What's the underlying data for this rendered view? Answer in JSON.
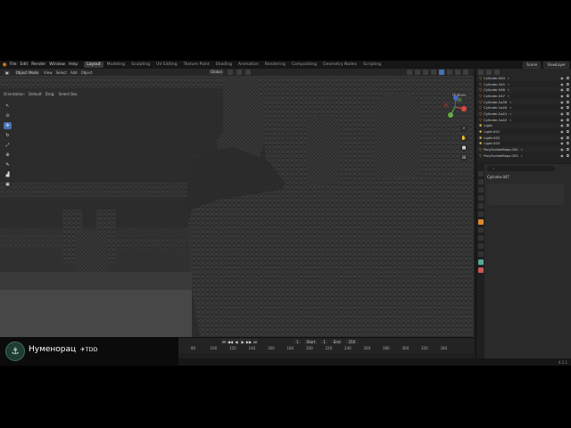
{
  "topbar": {
    "menu": [
      "File",
      "Edit",
      "Render",
      "Window",
      "Help"
    ],
    "workspaces": [
      "Layout",
      "Modeling",
      "Sculpting",
      "UV Editing",
      "Texture Paint",
      "Shading",
      "Animation",
      "Rendering",
      "Compositing",
      "Geometry Nodes",
      "Scripting"
    ],
    "active_workspace": "Layout",
    "scene": "Scene",
    "view_layer": "ViewLayer"
  },
  "viewport_header": {
    "mode": "Object Mode",
    "menus": [
      "View",
      "Select",
      "Add",
      "Object"
    ],
    "transform": "Global",
    "orientation_label": "Orientation:",
    "orientation_value": "Default",
    "drag_label": "Drag:",
    "drag_value": "Select Box",
    "options": "Options"
  },
  "outliner": {
    "items": [
      {
        "name": "Cylinder.044",
        "icon": "mesh-icon"
      },
      {
        "name": "Cylinder.045",
        "icon": "mesh-icon"
      },
      {
        "name": "Cylinder.046",
        "icon": "mesh-icon"
      },
      {
        "name": "Cylinder.047",
        "icon": "mesh-icon"
      },
      {
        "name": "Cylinder.1a39",
        "icon": "mesh-icon"
      },
      {
        "name": "Cylinder.1a40",
        "icon": "mesh-icon"
      },
      {
        "name": "Cylinder.1a41",
        "icon": "mesh-icon"
      },
      {
        "name": "Cylinder.1a42",
        "icon": "mesh-icon"
      },
      {
        "name": "Light",
        "icon": "light-icon"
      },
      {
        "name": "Light.001",
        "icon": "light-icon"
      },
      {
        "name": "Light.002",
        "icon": "light-icon"
      },
      {
        "name": "Light.003",
        "icon": "light-icon"
      },
      {
        "name": "PoryScribeMaps.002",
        "icon": "mesh-icon"
      },
      {
        "name": "PoryScribeMaps.003",
        "icon": "mesh-icon"
      }
    ]
  },
  "properties": {
    "object_name": "Cylinder.047"
  },
  "timeline": {
    "current_frame": "1",
    "start_label": "Start",
    "start": "1",
    "end_label": "End",
    "end": "250",
    "ruler": [
      "80",
      "100",
      "120",
      "140",
      "160",
      "180",
      "200",
      "220",
      "240",
      "260",
      "280",
      "300",
      "320",
      "340"
    ]
  },
  "status": {
    "version": "4.2.1"
  },
  "overlay": {
    "channel_name": "Нуменорац",
    "tag": "TDD"
  }
}
